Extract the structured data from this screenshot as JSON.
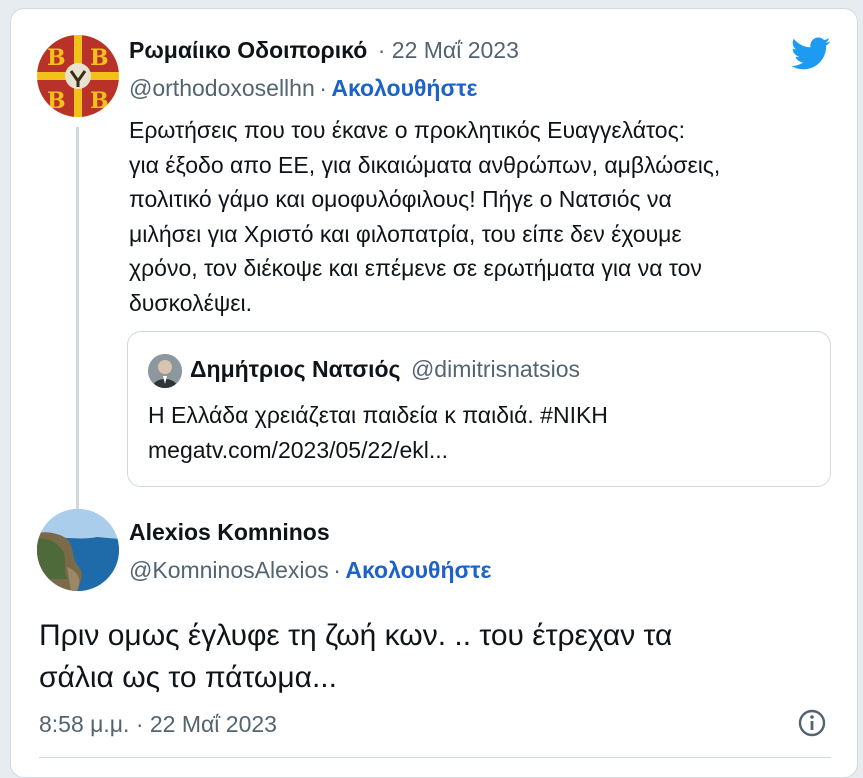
{
  "original_tweet": {
    "display_name": "Ρωμαίικο Οδοιπορικό",
    "date": "· 22 Μαΐ 2023",
    "handle": "@orthodoxosellhn",
    "separator": "·",
    "follow_label": "Ακολουθήστε",
    "text_lines": [
      "Ερωτήσεις που του έκανε ο προκλητικός Ευαγγελάτος:",
      "για έξοδο απο ΕΕ, για δικαιώματα ανθρώπων, αμβλώσεις,",
      "πολιτικό γάμο και ομοφυλόφιλους! Πήγε ο Νατσιός να",
      "μιλήσει για Χριστό και φιλοπατρία, του είπε δεν έχουμε",
      "χρόνο, τον διέκοψε και επέμενε σε ερωτήματα για να τον",
      "δυσκολέψει."
    ]
  },
  "quoted_tweet": {
    "display_name": "Δημήτριος Νατσιός",
    "handle": "@dimitrisnatsios",
    "text": "Η Ελλάδα χρειάζεται παιδεία κ παιδιά. #ΝΙΚΗ",
    "link": "megatv.com/2023/05/22/ekl..."
  },
  "reply_tweet": {
    "display_name": "Alexios Komninos",
    "handle": "@KomninosAlexios",
    "separator": "·",
    "follow_label": "Ακολουθήστε",
    "text_lines": [
      "Πριν ομως έγλυφε τη ζωή κων. ..  του έτρεχαν τα",
      "σάλια ως το πάτωμα..."
    ],
    "timestamp": "8:58 μ.μ. · 22 Μαΐ 2023"
  },
  "icons": {
    "brand": "twitter-bird-icon",
    "info": "info-icon"
  },
  "colors": {
    "link_blue": "#1d62c9",
    "twitter_blue": "#1d9bf0",
    "muted": "#536471",
    "border": "#cfd9de"
  }
}
